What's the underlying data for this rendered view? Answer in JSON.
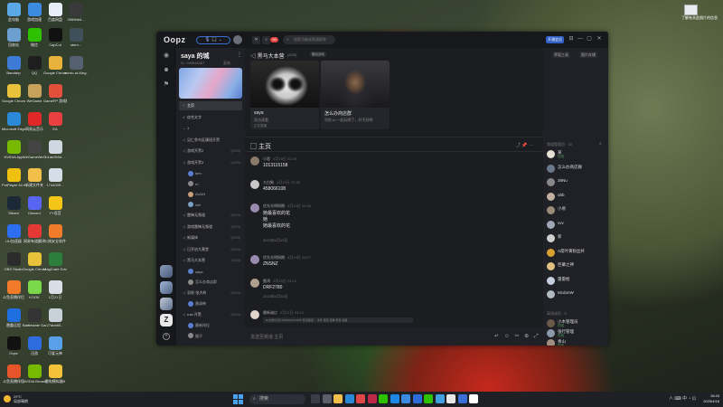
{
  "desktop": {
    "icons": [
      {
        "label": "此电脑",
        "color": "#5aa9e6"
      },
      {
        "label": "游戏加速",
        "color": "#3b8be0"
      },
      {
        "label": "百度网盘",
        "color": "#e8eef8"
      },
      {
        "label": "3959b64...",
        "color": "#3a3a3a"
      },
      {
        "label": "回收站",
        "color": "#6d9fd0"
      },
      {
        "label": "微信",
        "color": "#2dc100"
      },
      {
        "label": "CapCut",
        "color": "#111111"
      },
      {
        "label": "stem...",
        "color": "#40505a"
      },
      {
        "label": "Bandizip",
        "color": "#3e7bd6"
      },
      {
        "label": "QQ",
        "color": "#1e1e1e"
      },
      {
        "label": "Google Chrome 2",
        "color": "#e7b33a"
      },
      {
        "label": "mimic-of-King...",
        "color": "#556070"
      },
      {
        "label": "Google Chrome",
        "color": "#e9c13b"
      },
      {
        "label": "WeGame",
        "color": "#c8a25a"
      },
      {
        "label": "GameFP 游戏精灵",
        "color": "#e24f3a"
      },
      {
        "label": "Microsoft Edge",
        "color": "#2a8ad8"
      },
      {
        "label": "网易云音乐",
        "color": "#e02828"
      },
      {
        "label": "EA",
        "color": "#e84040"
      },
      {
        "label": "NVIDIA App",
        "color": "#76b900"
      },
      {
        "label": "WeGameWeGame",
        "color": "#444444"
      },
      {
        "label": "b1ae2b0d...",
        "color": "#cfd7e0"
      },
      {
        "label": "PotPlayer 64 bit",
        "color": "#f0c010"
      },
      {
        "label": "新建文件夹",
        "color": "#f2c04a"
      },
      {
        "label": "1744009...",
        "color": "#d5dde6"
      },
      {
        "label": "Steam",
        "color": "#1b2838"
      },
      {
        "label": "Discord",
        "color": "#5865f2"
      },
      {
        "label": "YY语音",
        "color": "#f5c518"
      },
      {
        "label": "UU加速器",
        "color": "#2d6ff0"
      },
      {
        "label": "网易有道翻译",
        "color": "#e53935"
      },
      {
        "label": "火绒安全软件",
        "color": "#f07b2a"
      },
      {
        "label": "OBS Studio",
        "color": "#2b2b2b"
      },
      {
        "label": "Google Chrome",
        "color": "#e8c23a"
      },
      {
        "label": "MagCrate Driver",
        "color": "#2c7f3a"
      },
      {
        "label": "斗鱼直播伴侣",
        "color": "#f27b2a"
      },
      {
        "label": "KOOK",
        "color": "#7bd84b"
      },
      {
        "label": "1月21日",
        "color": "#d8dde6"
      },
      {
        "label": "雷霆远程",
        "color": "#1f6fe0"
      },
      {
        "label": "Battlestate Games L...",
        "color": "#333333"
      },
      {
        "label": "27abe80...",
        "color": "#c8d0d8"
      },
      {
        "label": "Oopz",
        "color": "#111111"
      },
      {
        "label": "迅游",
        "color": "#2e6ce0"
      },
      {
        "label": "可爱元神",
        "color": "#5aa0e8"
      },
      {
        "label": "斗鱼直播伴侣",
        "color": "#e8542a"
      },
      {
        "label": "NVIDIA Broadcast",
        "color": "#76b900"
      },
      {
        "label": "雷电模拟器9",
        "color": "#f2c23a"
      }
    ],
    "corner_icon_label": "了解有关此图片的信息"
  },
  "window": {
    "logo": "Oopz",
    "voice_bar": "🎙 🎧 ⌄",
    "search_placeholder": "搜索功能或频道昵称",
    "notify_badge": "99",
    "rank_button": "开通会员",
    "controls": [
      "⊟",
      "—",
      "▢",
      "✕"
    ]
  },
  "rail": {
    "icons": [
      "home-icon",
      "discover-icon",
      "message-icon"
    ]
  },
  "server": {
    "name": "saya 的城",
    "id": "ID: 095845467",
    "copy_label": "复制",
    "channels": [
      {
        "icon": "≡",
        "label": "主页",
        "selected": true,
        "meta": ""
      },
      {
        "icon": "#",
        "label": "综合文字",
        "selected": false,
        "meta": ""
      },
      {
        "icon": "⌄",
        "label": "1",
        "selected": false,
        "meta": ""
      },
      {
        "icon": "◁",
        "label": "见仁争鸟区康班开黑",
        "selected": false,
        "meta": ""
      },
      {
        "icon": "◁",
        "label": "游戏开黑2",
        "selected": false,
        "meta": "(0/20)"
      },
      {
        "icon": "◁",
        "label": "游戏开黑3",
        "selected": false,
        "meta": "(4/20)"
      }
    ],
    "voice_members_1": [
      "tarn",
      "rri",
      "AUAN",
      "iubi"
    ],
    "channels_2": [
      {
        "icon": "◁",
        "label": "雷锋无频道",
        "meta": "(0/20)"
      },
      {
        "icon": "◁",
        "label": "游戏雷锋无频道",
        "meta": "(0/20)"
      },
      {
        "icon": "◁",
        "label": "新媒体",
        "meta": "(0/20)"
      },
      {
        "icon": "◁",
        "label": "已开启大黄堂",
        "meta": "(0/20)"
      },
      {
        "icon": "◁",
        "label": "黑马大本营",
        "meta": "(4/20)"
      }
    ],
    "voice_members_2": [
      "saya",
      "怎么办商店群"
    ],
    "channels_3": [
      {
        "icon": "◁",
        "label": "羽毛·张大岭",
        "meta": "(0/20)"
      }
    ],
    "voice_members_3": [
      "邀请神"
    ],
    "channels_4": [
      {
        "icon": "◁",
        "label": "rust 开黑",
        "meta": "(0/20)"
      }
    ],
    "voice_members_4": [
      "最新排位",
      "猫子"
    ]
  },
  "main": {
    "section_title": "黑马大本营",
    "section_sub": "(2/20)",
    "section_more": "最后活动",
    "video_cards": [
      {
        "title": "saya",
        "sub": "双击观看",
        "sub2": "正在直播",
        "badge": "屏幕共享"
      },
      {
        "title": "怎么办商店群",
        "sub": "华佑 to 一起玩啊了，好不好啊",
        "sub2": ""
      }
    ],
    "chat_title": "主页",
    "chat_tools": "⤴ 📌 ⋯",
    "messages": [
      {
        "name": "小君",
        "time": "4月19日 22:39",
        "lines": [
          "1013115158"
        ],
        "color": "#8a7a6a"
      },
      {
        "name": "大白狗",
        "time": "4月19日 22:35",
        "lines": [
          "458066108"
        ],
        "color": "#c9c9c9"
      },
      {
        "name": "优先光明网期",
        "time": "4月19日 22:48",
        "lines": [
          "她最喜欢的花",
          "她",
          "她最喜欢的花"
        ],
        "color": "#9a8ab0"
      },
      {
        "name": "优先光明网期",
        "time": "4月19日 23:07",
        "lines": [
          "ZNSNZ"
        ],
        "color": "#9a8ab0"
      },
      {
        "name": "雷鸿",
        "time": "4月19日 23:12",
        "lines": [
          "DRF2780"
        ],
        "color": "#b0a090"
      },
      {
        "name": "最新诚亿",
        "time": "4月21日 03:19",
        "lines": [],
        "color": "#e0d6cc"
      }
    ],
    "day_separators": [
      "2024年4月19日",
      "2024年4月20日"
    ],
    "snippet": "Ø  [文件分享] 2024/04/12 RPG 导出路径 ... 文件   更多   查看   转发   收藏",
    "composer_placeholder": "发送至频道 主页",
    "composer_tools": "↵ ☺ ✂ ⊕ ⤢"
  },
  "right": {
    "top_buttons": [
      "界面工具",
      "图片存储"
    ],
    "online_header": "频道管理员 · 30",
    "members": [
      {
        "name": "某",
        "status": "在线",
        "color": "#e8e0d6"
      },
      {
        "name": "怎么办商店群",
        "status": "",
        "color": "#6b7a8a"
      },
      {
        "name": "39Nu",
        "status": "",
        "color": "#888888"
      },
      {
        "name": "obb",
        "status": "",
        "color": "#c0b0a0"
      },
      {
        "name": "小易",
        "status": "",
        "color": "#9a8a7a"
      },
      {
        "name": "vvv",
        "status": "",
        "color": "#a0a8b8"
      },
      {
        "name": "新",
        "status": "",
        "color": "#d0d0d0"
      },
      {
        "name": "A席叶黄粉丝杆",
        "status": "",
        "color": "#d8a030"
      },
      {
        "name": "巨幕之神",
        "status": "",
        "color": "#e0c080"
      },
      {
        "name": "雷雷枪",
        "status": "",
        "color": "#c8d0e0"
      },
      {
        "name": "McdonW",
        "status": "",
        "color": "#b0b8c0"
      }
    ],
    "offline_header": "离线成员 · 5",
    "offline_members": [
      {
        "name": "小木管理员",
        "status": "在线",
        "color": "#6a5a4a"
      },
      {
        "name": "张行管理",
        "status": "在线",
        "color": "#8a9aaa"
      },
      {
        "name": "青山",
        "status": "在线",
        "color": "#a09080"
      }
    ]
  },
  "taskbar": {
    "weather_temp": "29°C",
    "weather_desc": "局部晴朗",
    "search_label": "搜索",
    "tray": "∧  ⌨ 中  ◔ ⊡",
    "time": "16:43",
    "date": "2025/4/18"
  }
}
